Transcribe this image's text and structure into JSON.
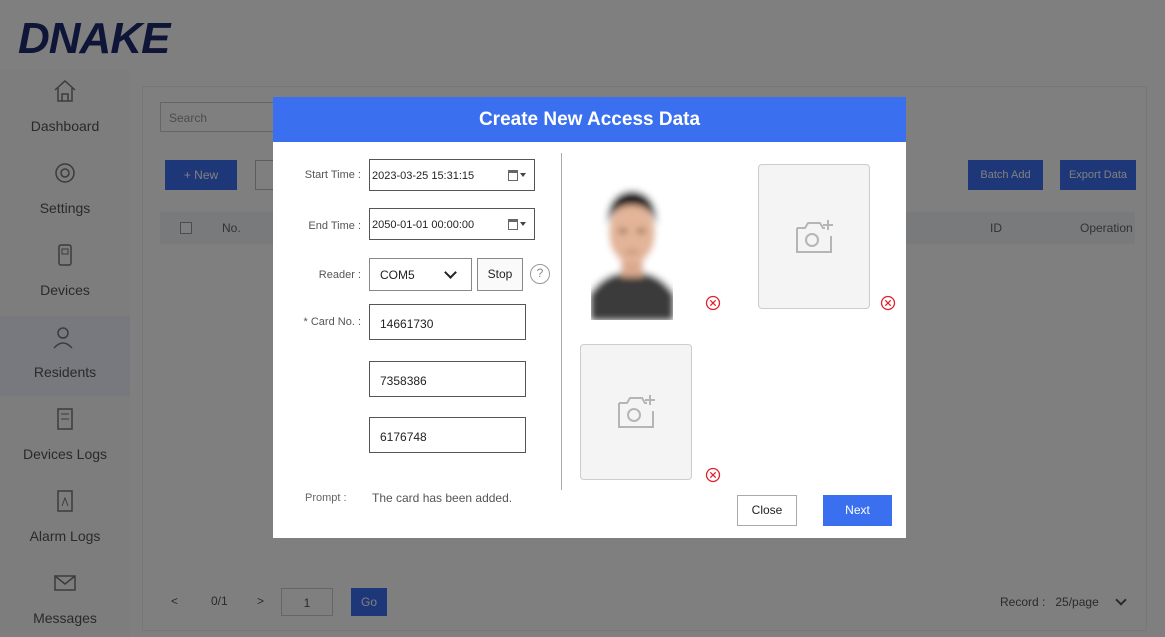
{
  "app": {
    "logo": "DNAKE",
    "sidebar": [
      {
        "label": "Dashboard",
        "icon": "home-icon"
      },
      {
        "label": "Settings",
        "icon": "gear-icon"
      },
      {
        "label": "Devices",
        "icon": "device-icon"
      },
      {
        "label": "Residents",
        "icon": "residents-icon"
      },
      {
        "label": "Devices Logs",
        "icon": "device-log-icon"
      },
      {
        "label": "Alarm Logs",
        "icon": "alarm-log-icon"
      },
      {
        "label": "Messages",
        "icon": "mail-icon"
      }
    ],
    "toolbar": {
      "search_placeholder": "Search",
      "new_label": "+ New",
      "right_btn1": "Batch Add",
      "right_btn2": "Export Data"
    },
    "table": {
      "headers": [
        "No.",
        "ID",
        "Operation"
      ]
    },
    "pagination": {
      "prev": "<",
      "count": "0/1",
      "next": ">",
      "page_input": "1",
      "go": "Go",
      "size_label": "Record :",
      "size_value": "25/page"
    }
  },
  "modal": {
    "title": "Create New Access Data",
    "fields": {
      "start_time_label": "Start Time :",
      "start_time_value": "2023-03-25  15:31:15",
      "end_time_label": "End Time :",
      "end_time_value": "2050-01-01 00:00:00",
      "reader_label": "Reader :",
      "reader_value": "COM5",
      "stop_label": "Stop",
      "help_label": "?",
      "card_label": "* Card No. :",
      "card_values": [
        "14661730",
        "7358386",
        "6176748"
      ],
      "prompt_label": "Prompt :",
      "prompt_text": "The card has been added."
    },
    "buttons": {
      "close": "Close",
      "next": "Next"
    },
    "colors": {
      "accent": "#3a6ff0",
      "delete": "#e0202a"
    }
  }
}
